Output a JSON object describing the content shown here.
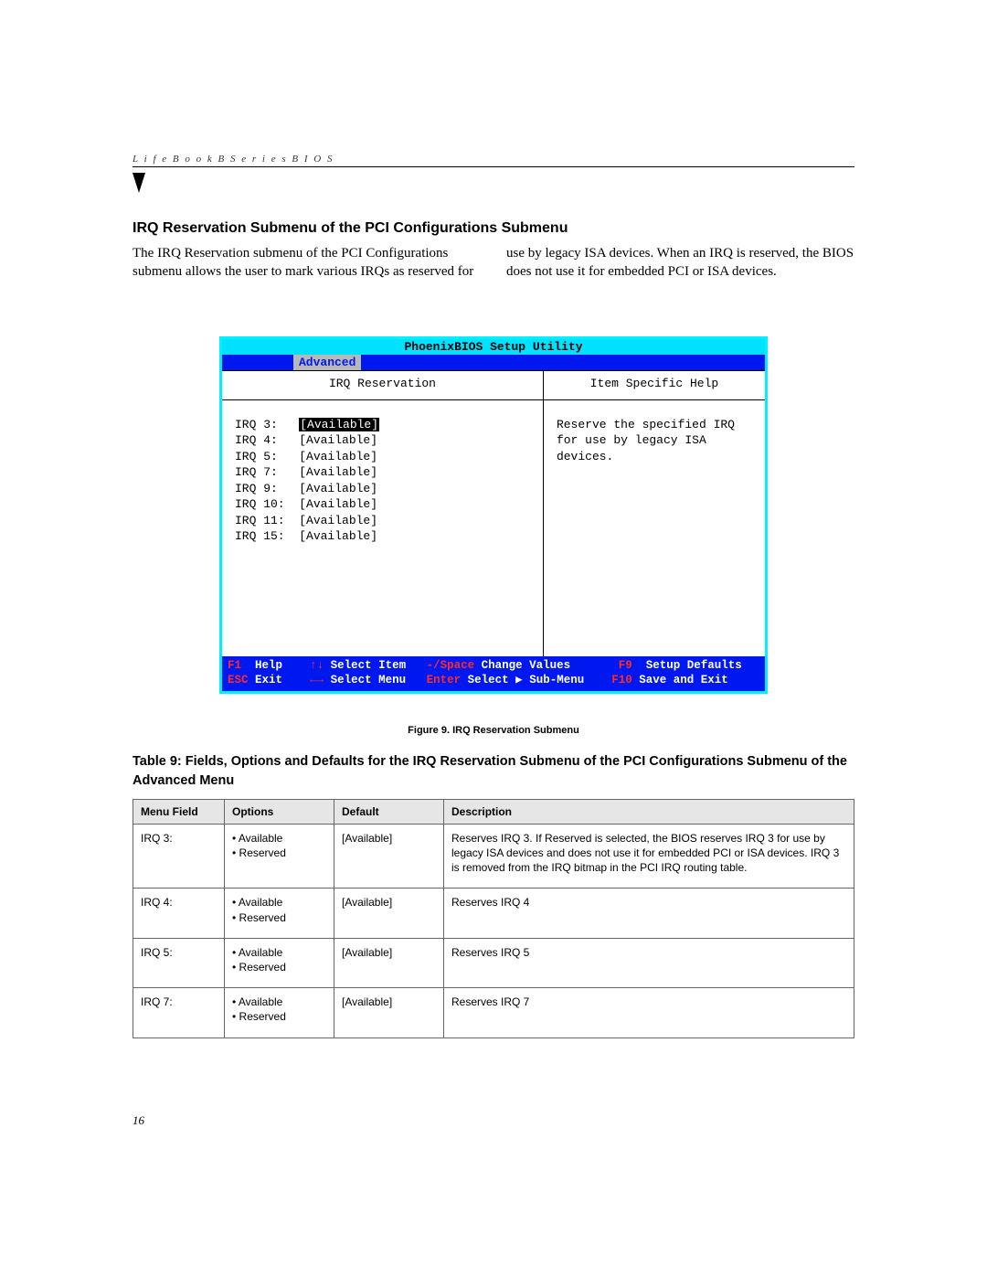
{
  "header": "L i f e B o o k   B   S e r i e s   B I O S",
  "section_title": "IRQ Reservation Submenu of the PCI Configurations Submenu",
  "body_text": "The IRQ Reservation submenu of the PCI Configurations submenu allows the user to mark various IRQs as reserved for use by legacy ISA devices. When an IRQ is reserved, the BIOS does not use it for embedded PCI or ISA devices.",
  "bios": {
    "title": "PhoenixBIOS Setup Utility",
    "active_tab": "Advanced",
    "left_header": "IRQ Reservation",
    "right_header": "Item Specific Help",
    "help_text": "Reserve the specified IRQ for use by legacy ISA devices.",
    "irqs": [
      {
        "label": "IRQ 3:",
        "value": "[Available]",
        "selected": true
      },
      {
        "label": "IRQ 4:",
        "value": "[Available]",
        "selected": false
      },
      {
        "label": "IRQ 5:",
        "value": "[Available]",
        "selected": false
      },
      {
        "label": "IRQ 7:",
        "value": "[Available]",
        "selected": false
      },
      {
        "label": "IRQ 9:",
        "value": "[Available]",
        "selected": false
      },
      {
        "label": "IRQ 10:",
        "value": "[Available]",
        "selected": false
      },
      {
        "label": "IRQ 11:",
        "value": "[Available]",
        "selected": false
      },
      {
        "label": "IRQ 15:",
        "value": "[Available]",
        "selected": false
      }
    ],
    "footer": {
      "f1": "F1",
      "help": "Help",
      "arrows_v": "↑↓",
      "sel_item": "Select Item",
      "minus_space": "-/Space",
      "change": "Change Values",
      "f9": "F9",
      "setup_def": "Setup Defaults",
      "esc": "ESC",
      "exit": "Exit",
      "arrows_h": "←→",
      "sel_menu": "Select Menu",
      "enter": "Enter",
      "sel_sub": "Select ▶ Sub-Menu",
      "f10": "F10",
      "save": "Save and Exit"
    }
  },
  "figure_caption": "Figure 9.  IRQ Reservation Submenu",
  "table_title": "Table 9: Fields, Options and Defaults for the IRQ Reservation Submenu of the PCI Configurations Submenu of the Advanced Menu",
  "table": {
    "headers": [
      "Menu Field",
      "Options",
      "Default",
      "Description"
    ],
    "rows": [
      {
        "field": "IRQ 3:",
        "options": [
          "Available",
          "Reserved"
        ],
        "default": "[Available]",
        "desc": "Reserves IRQ 3. If Reserved is selected, the BIOS reserves IRQ 3 for use by legacy ISA devices and does not use it for embedded PCI or ISA devices. IRQ 3 is removed from the IRQ bitmap in the PCI IRQ routing table."
      },
      {
        "field": "IRQ 4:",
        "options": [
          "Available",
          "Reserved"
        ],
        "default": "[Available]",
        "desc": "Reserves IRQ 4"
      },
      {
        "field": "IRQ 5:",
        "options": [
          "Available",
          "Reserved"
        ],
        "default": "[Available]",
        "desc": "Reserves IRQ 5"
      },
      {
        "field": "IRQ 7:",
        "options": [
          "Available",
          "Reserved"
        ],
        "default": "[Available]",
        "desc": "Reserves IRQ 7"
      }
    ]
  },
  "page_number": "16"
}
